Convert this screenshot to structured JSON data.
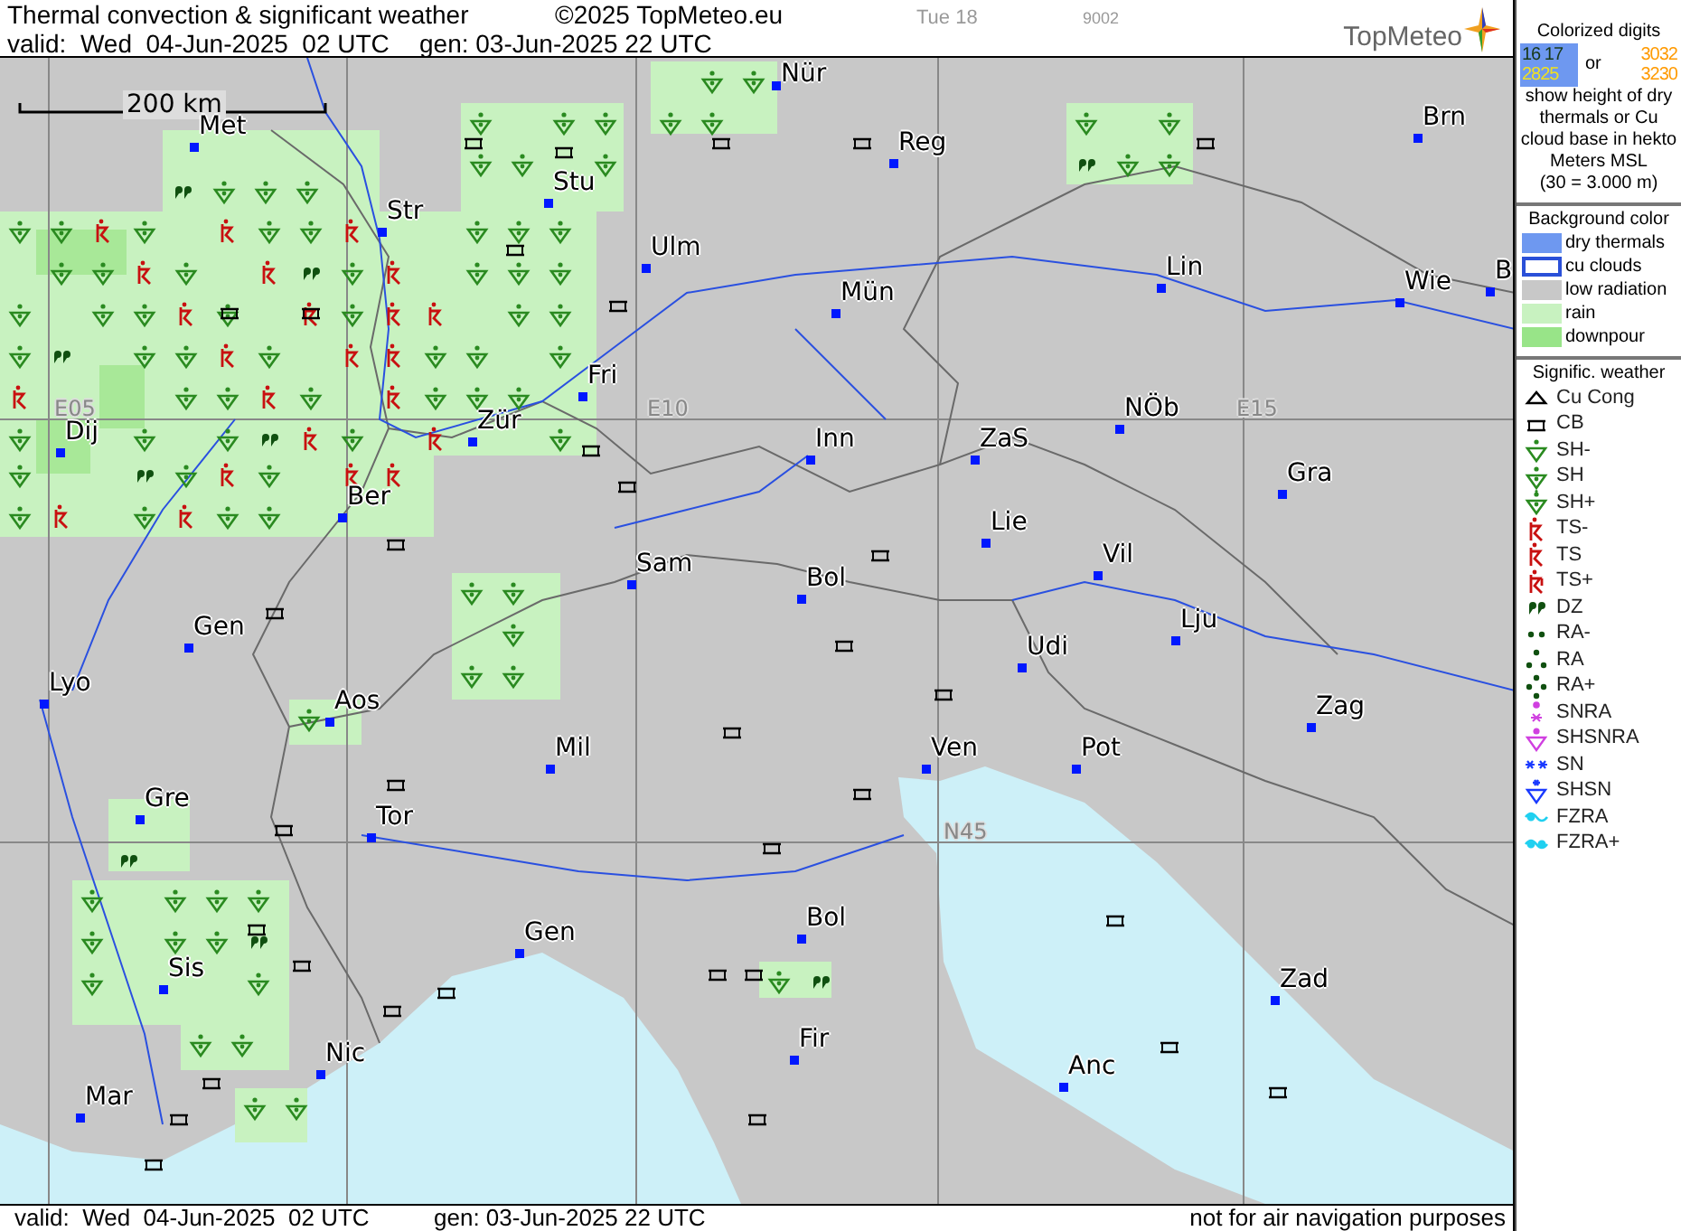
{
  "header": {
    "title": "Thermal convection & significant weather",
    "copyright": "©2025 TopMeteo.eu",
    "day_label": "Tue 18",
    "code": "9002",
    "valid": "valid:  Wed  04-Jun-2025  02 UTC",
    "generated": "gen: 03-Jun-2025 22 UTC",
    "logo": "TopMeteo"
  },
  "map": {
    "scale": "200 km",
    "grid_labels": [
      "E05",
      "E10",
      "E15",
      "N45"
    ],
    "cities": [
      "Nür",
      "Reg",
      "Brn",
      "Met",
      "Stu",
      "Str",
      "Ulm",
      "Mün",
      "Lin",
      "Wie",
      "B",
      "Fri",
      "Zür",
      "Inn",
      "ZaS",
      "NÖb",
      "Gra",
      "Dij",
      "Ber",
      "Lie",
      "Vil",
      "Sam",
      "Bol",
      "Lju",
      "Gen",
      "Udi",
      "Lyo",
      "Aos",
      "Zag",
      "Mil",
      "Ven",
      "Pot",
      "Gre",
      "Tor",
      "Gen",
      "Bol",
      "Zad",
      "Sis",
      "Fir",
      "Nic",
      "Anc",
      "Mar"
    ]
  },
  "legend": {
    "digits_title": "Colorized digits",
    "digits_box": [
      {
        "text": "16 17",
        "color": "#183818"
      },
      {
        "text": "2825",
        "color": "#f0e020"
      }
    ],
    "digits_or": "or",
    "digits_plain": [
      {
        "text": "3032",
        "color": "#ff9a00"
      },
      {
        "text": "3230",
        "color": "#ff9a00"
      }
    ],
    "digits_note": "show height of dry thermals or Cu cloud base in hekto Meters MSL",
    "digits_example": "(30 = 3.000 m)",
    "background_title": "Background color",
    "background": [
      {
        "label": "dry thermals",
        "color": "#6e98f0",
        "outlined": false
      },
      {
        "label": "cu clouds",
        "color": "#ffffff",
        "outlined": true
      },
      {
        "label": "low radiation",
        "color": "#c8c8c8",
        "outlined": false
      },
      {
        "label": "rain",
        "color": "#c8f2c0",
        "outlined": false
      },
      {
        "label": "downpour",
        "color": "#98e488",
        "outlined": false
      }
    ],
    "weather_title": "Signific. weather",
    "weather": [
      {
        "label": "Cu Cong",
        "kind": "cucong"
      },
      {
        "label": "CB",
        "kind": "cb"
      },
      {
        "label": "SH-",
        "kind": "shlight"
      },
      {
        "label": "SH",
        "kind": "sh"
      },
      {
        "label": "SH+",
        "kind": "shheavy"
      },
      {
        "label": "TS-",
        "kind": "tslight"
      },
      {
        "label": "TS",
        "kind": "ts"
      },
      {
        "label": "TS+",
        "kind": "tsheavy"
      },
      {
        "label": "DZ",
        "kind": "dz"
      },
      {
        "label": "RA-",
        "kind": "ralight"
      },
      {
        "label": "RA",
        "kind": "ra"
      },
      {
        "label": "RA+",
        "kind": "raheavy"
      },
      {
        "label": "SNRA",
        "kind": "snra"
      },
      {
        "label": "SHSNRA",
        "kind": "shsnra"
      },
      {
        "label": "SN",
        "kind": "sn"
      },
      {
        "label": "SHSN",
        "kind": "shsn"
      },
      {
        "label": "FZRA",
        "kind": "fzra"
      },
      {
        "label": "FZRA+",
        "kind": "fzraheavy"
      }
    ]
  },
  "footer": {
    "valid": "valid:  Wed  04-Jun-2025  02 UTC",
    "generated": "gen: 03-Jun-2025 22 UTC",
    "disclaimer": "not for air navigation purposes"
  }
}
